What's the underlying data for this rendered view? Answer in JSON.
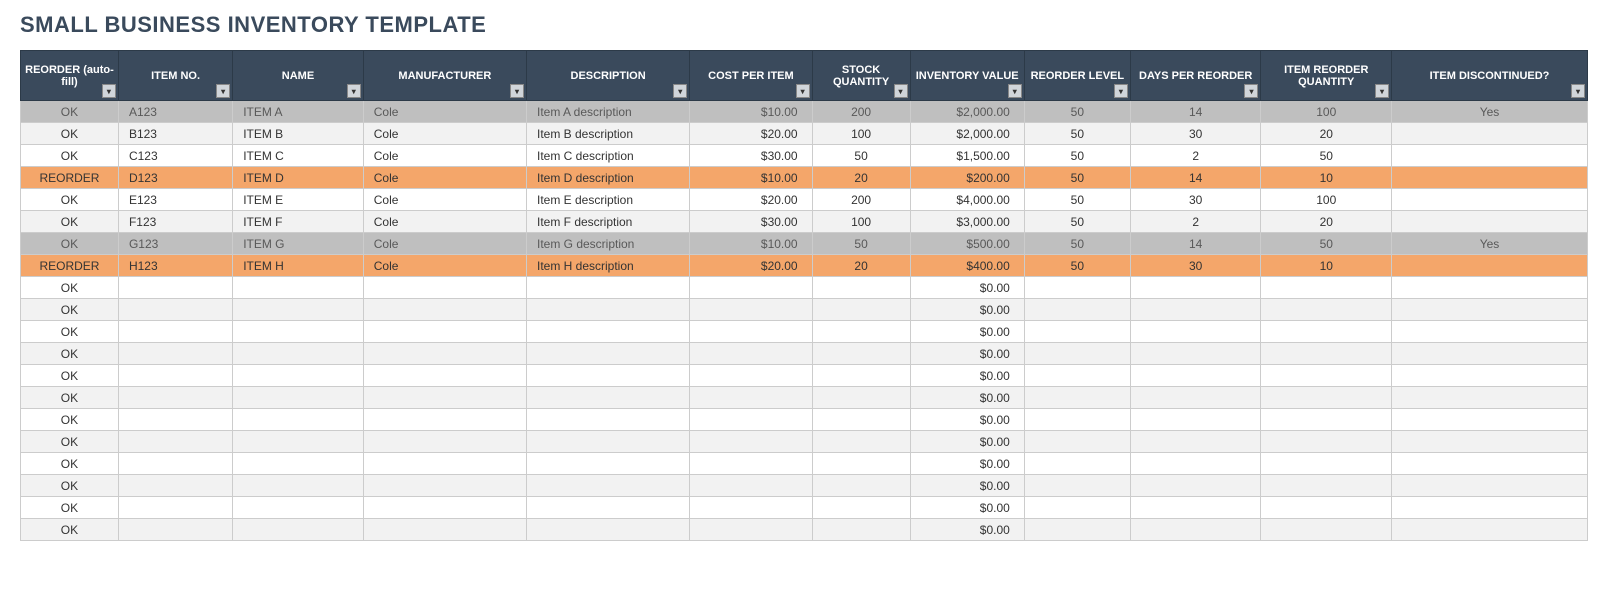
{
  "title": "SMALL BUSINESS INVENTORY TEMPLATE",
  "headers": [
    "REORDER (auto-fill)",
    "ITEM NO.",
    "NAME",
    "MANUFACTURER",
    "DESCRIPTION",
    "COST PER ITEM",
    "STOCK QUANTITY",
    "INVENTORY VALUE",
    "REORDER LEVEL",
    "DAYS PER REORDER",
    "ITEM REORDER QUANTITY",
    "ITEM DISCONTINUED?"
  ],
  "rows": [
    {
      "status": "discontinued",
      "reorder": "OK",
      "item_no": "A123",
      "name": "ITEM A",
      "manufacturer": "Cole",
      "description": "Item A description",
      "cost": "$10.00",
      "stock": "200",
      "inv_value": "$2,000.00",
      "reorder_level": "50",
      "days": "14",
      "reorder_qty": "100",
      "discontinued": "Yes"
    },
    {
      "status": "alt",
      "reorder": "OK",
      "item_no": "B123",
      "name": "ITEM B",
      "manufacturer": "Cole",
      "description": "Item B description",
      "cost": "$20.00",
      "stock": "100",
      "inv_value": "$2,000.00",
      "reorder_level": "50",
      "days": "30",
      "reorder_qty": "20",
      "discontinued": ""
    },
    {
      "status": "",
      "reorder": "OK",
      "item_no": "C123",
      "name": "ITEM C",
      "manufacturer": "Cole",
      "description": "Item C description",
      "cost": "$30.00",
      "stock": "50",
      "inv_value": "$1,500.00",
      "reorder_level": "50",
      "days": "2",
      "reorder_qty": "50",
      "discontinued": ""
    },
    {
      "status": "reorder",
      "reorder": "REORDER",
      "item_no": "D123",
      "name": "ITEM D",
      "manufacturer": "Cole",
      "description": "Item D description",
      "cost": "$10.00",
      "stock": "20",
      "inv_value": "$200.00",
      "reorder_level": "50",
      "days": "14",
      "reorder_qty": "10",
      "discontinued": ""
    },
    {
      "status": "",
      "reorder": "OK",
      "item_no": "E123",
      "name": "ITEM E",
      "manufacturer": "Cole",
      "description": "Item E description",
      "cost": "$20.00",
      "stock": "200",
      "inv_value": "$4,000.00",
      "reorder_level": "50",
      "days": "30",
      "reorder_qty": "100",
      "discontinued": ""
    },
    {
      "status": "alt",
      "reorder": "OK",
      "item_no": "F123",
      "name": "ITEM F",
      "manufacturer": "Cole",
      "description": "Item F description",
      "cost": "$30.00",
      "stock": "100",
      "inv_value": "$3,000.00",
      "reorder_level": "50",
      "days": "2",
      "reorder_qty": "20",
      "discontinued": ""
    },
    {
      "status": "discontinued",
      "reorder": "OK",
      "item_no": "G123",
      "name": "ITEM G",
      "manufacturer": "Cole",
      "description": "Item G description",
      "cost": "$10.00",
      "stock": "50",
      "inv_value": "$500.00",
      "reorder_level": "50",
      "days": "14",
      "reorder_qty": "50",
      "discontinued": "Yes"
    },
    {
      "status": "reorder",
      "reorder": "REORDER",
      "item_no": "H123",
      "name": "ITEM H",
      "manufacturer": "Cole",
      "description": "Item H description",
      "cost": "$20.00",
      "stock": "20",
      "inv_value": "$400.00",
      "reorder_level": "50",
      "days": "30",
      "reorder_qty": "10",
      "discontinued": ""
    },
    {
      "status": "",
      "reorder": "OK",
      "item_no": "",
      "name": "",
      "manufacturer": "",
      "description": "",
      "cost": "",
      "stock": "",
      "inv_value": "$0.00",
      "reorder_level": "",
      "days": "",
      "reorder_qty": "",
      "discontinued": ""
    },
    {
      "status": "alt",
      "reorder": "OK",
      "item_no": "",
      "name": "",
      "manufacturer": "",
      "description": "",
      "cost": "",
      "stock": "",
      "inv_value": "$0.00",
      "reorder_level": "",
      "days": "",
      "reorder_qty": "",
      "discontinued": ""
    },
    {
      "status": "",
      "reorder": "OK",
      "item_no": "",
      "name": "",
      "manufacturer": "",
      "description": "",
      "cost": "",
      "stock": "",
      "inv_value": "$0.00",
      "reorder_level": "",
      "days": "",
      "reorder_qty": "",
      "discontinued": ""
    },
    {
      "status": "alt",
      "reorder": "OK",
      "item_no": "",
      "name": "",
      "manufacturer": "",
      "description": "",
      "cost": "",
      "stock": "",
      "inv_value": "$0.00",
      "reorder_level": "",
      "days": "",
      "reorder_qty": "",
      "discontinued": ""
    },
    {
      "status": "",
      "reorder": "OK",
      "item_no": "",
      "name": "",
      "manufacturer": "",
      "description": "",
      "cost": "",
      "stock": "",
      "inv_value": "$0.00",
      "reorder_level": "",
      "days": "",
      "reorder_qty": "",
      "discontinued": ""
    },
    {
      "status": "alt",
      "reorder": "OK",
      "item_no": "",
      "name": "",
      "manufacturer": "",
      "description": "",
      "cost": "",
      "stock": "",
      "inv_value": "$0.00",
      "reorder_level": "",
      "days": "",
      "reorder_qty": "",
      "discontinued": ""
    },
    {
      "status": "",
      "reorder": "OK",
      "item_no": "",
      "name": "",
      "manufacturer": "",
      "description": "",
      "cost": "",
      "stock": "",
      "inv_value": "$0.00",
      "reorder_level": "",
      "days": "",
      "reorder_qty": "",
      "discontinued": ""
    },
    {
      "status": "alt",
      "reorder": "OK",
      "item_no": "",
      "name": "",
      "manufacturer": "",
      "description": "",
      "cost": "",
      "stock": "",
      "inv_value": "$0.00",
      "reorder_level": "",
      "days": "",
      "reorder_qty": "",
      "discontinued": ""
    },
    {
      "status": "",
      "reorder": "OK",
      "item_no": "",
      "name": "",
      "manufacturer": "",
      "description": "",
      "cost": "",
      "stock": "",
      "inv_value": "$0.00",
      "reorder_level": "",
      "days": "",
      "reorder_qty": "",
      "discontinued": ""
    },
    {
      "status": "alt",
      "reorder": "OK",
      "item_no": "",
      "name": "",
      "manufacturer": "",
      "description": "",
      "cost": "",
      "stock": "",
      "inv_value": "$0.00",
      "reorder_level": "",
      "days": "",
      "reorder_qty": "",
      "discontinued": ""
    },
    {
      "status": "",
      "reorder": "OK",
      "item_no": "",
      "name": "",
      "manufacturer": "",
      "description": "",
      "cost": "",
      "stock": "",
      "inv_value": "$0.00",
      "reorder_level": "",
      "days": "",
      "reorder_qty": "",
      "discontinued": ""
    },
    {
      "status": "alt",
      "reorder": "OK",
      "item_no": "",
      "name": "",
      "manufacturer": "",
      "description": "",
      "cost": "",
      "stock": "",
      "inv_value": "$0.00",
      "reorder_level": "",
      "days": "",
      "reorder_qty": "",
      "discontinued": ""
    }
  ]
}
